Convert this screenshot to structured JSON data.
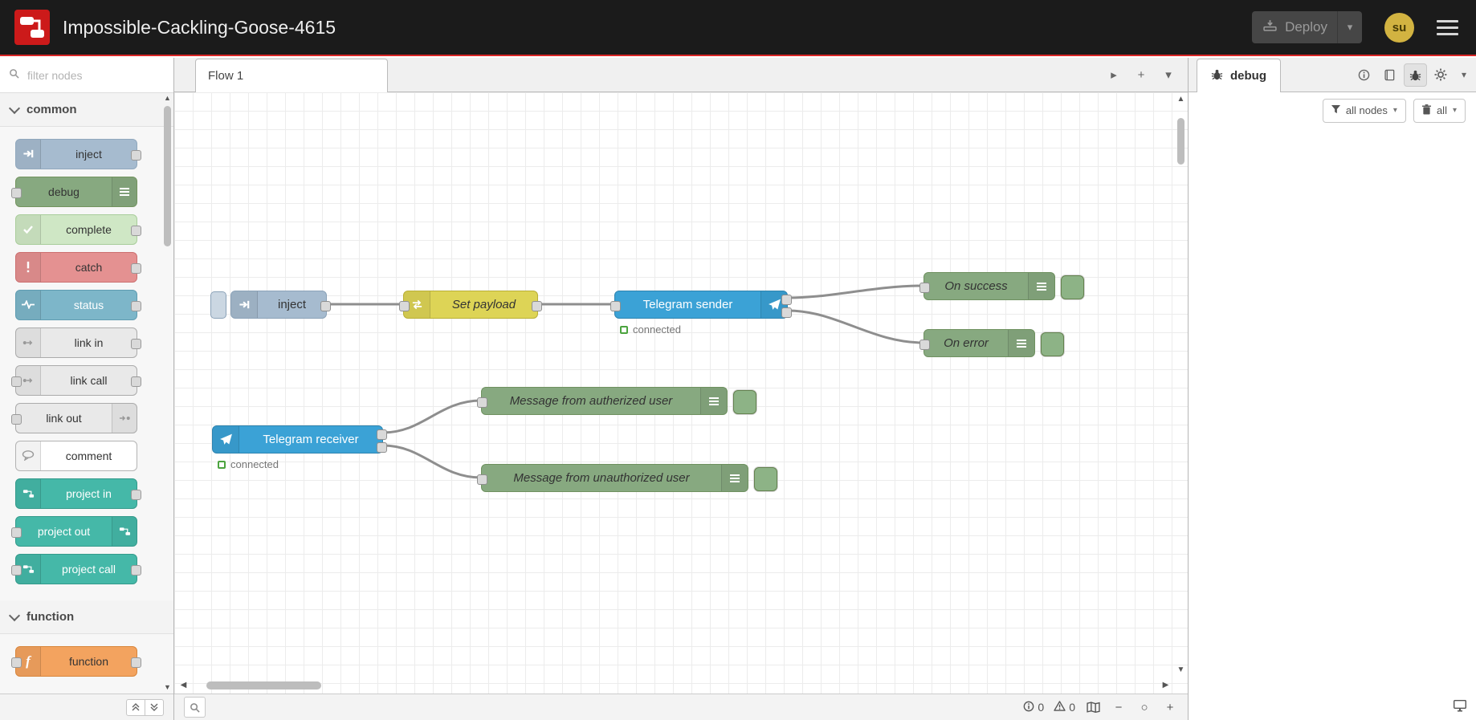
{
  "header": {
    "title": "Impossible-Cackling-Goose-4615",
    "deploy": {
      "label": "Deploy"
    },
    "user": {
      "initials": "su"
    },
    "colors": {
      "header_bg": "#1b1b1b",
      "accent_red": "#d92626",
      "logo_red": "#cc1a1a",
      "avatar_bg": "#d2b341"
    }
  },
  "palette": {
    "filter_placeholder": "filter nodes",
    "categories": [
      {
        "label": "common",
        "items": [
          {
            "label": "inject",
            "color": "#a6bbcf"
          },
          {
            "label": "debug",
            "color": "#87a980"
          },
          {
            "label": "complete",
            "color": "#cfe7c5"
          },
          {
            "label": "catch",
            "color": "#e49191"
          },
          {
            "label": "status",
            "color": "#7db6c9"
          },
          {
            "label": "link in",
            "color": "#e9e9e9"
          },
          {
            "label": "link call",
            "color": "#e9e9e9"
          },
          {
            "label": "link out",
            "color": "#e9e9e9"
          },
          {
            "label": "comment",
            "color": "#ffffff"
          },
          {
            "label": "project in",
            "color": "#45b8a8"
          },
          {
            "label": "project out",
            "color": "#45b8a8"
          },
          {
            "label": "project call",
            "color": "#45b8a8"
          }
        ]
      },
      {
        "label": "function",
        "items": [
          {
            "label": "function",
            "color": "#f3a35f"
          }
        ]
      }
    ]
  },
  "workspace": {
    "tab_label": "Flow 1",
    "nodes": {
      "inject": {
        "label": "inject",
        "color": "#a6bbcf"
      },
      "set_payload": {
        "label": "Set payload",
        "color": "#ddd456"
      },
      "telegram_sender": {
        "label": "Telegram sender",
        "status": "connected",
        "color": "#3ba2d6"
      },
      "on_success": {
        "label": "On success",
        "color": "#87a980"
      },
      "on_error": {
        "label": "On error",
        "color": "#87a980"
      },
      "telegram_receiver": {
        "label": "Telegram receiver",
        "status": "connected",
        "color": "#3ba2d6"
      },
      "msg_authorized": {
        "label": "Message from autherized user",
        "color": "#87a980"
      },
      "msg_unauthorized": {
        "label": "Message from unauthorized user",
        "color": "#87a980"
      }
    },
    "footer": {
      "info_count": "0",
      "warning_count": "0"
    }
  },
  "debug_panel": {
    "tab_label": "debug",
    "filter_button": "all nodes",
    "clear_button": "all"
  },
  "icons": [
    "node-red-logo",
    "deploy-icon",
    "hamburger-menu-icon",
    "search-icon",
    "chevron-icons",
    "inject-arrow-icon",
    "list-icon",
    "check-icon",
    "exclamation-icon",
    "status-pulse-icon",
    "link-icon",
    "comment-bubble-icon",
    "project-icon",
    "function-f-icon",
    "telegram-plane-icon",
    "info-icon",
    "book-icon",
    "bug-icon",
    "gear-icon",
    "funnel-icon",
    "trash-icon",
    "navigator-map-icon",
    "warning-triangle-icon",
    "zoom-icons",
    "external-window-icon"
  ]
}
